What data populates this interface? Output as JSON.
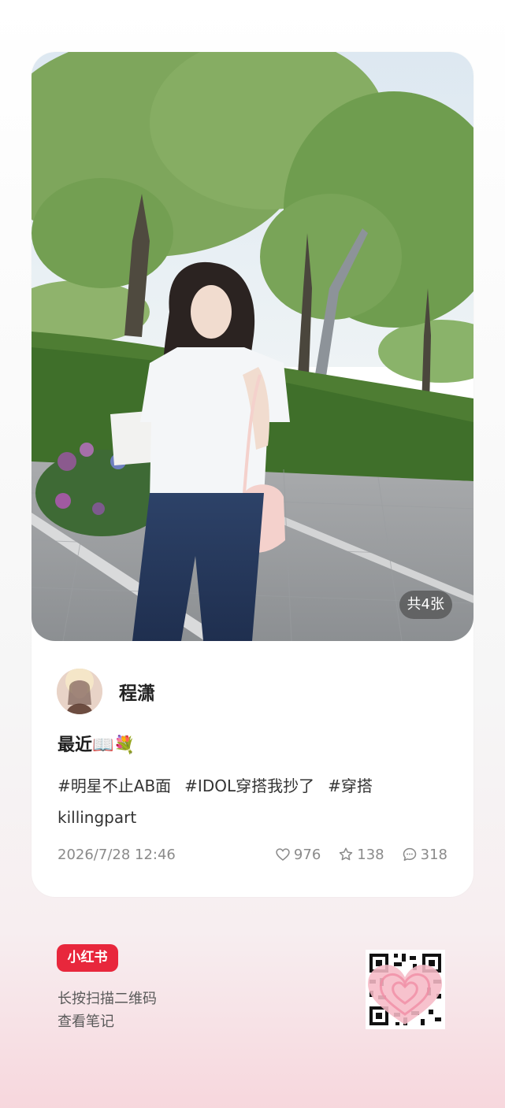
{
  "card": {
    "image_count": "共4张"
  },
  "author": {
    "name": "程潇"
  },
  "note": {
    "title": "最近📖💐",
    "tags": [
      "#明星不止AB面",
      "#IDOL穿搭我抄了",
      "#穿搭"
    ],
    "tags_extra": "killingpart",
    "date": "2026/7/28 12:46",
    "likes": "976",
    "favorites": "138",
    "comments": "318"
  },
  "footer": {
    "brand": "小红书",
    "line1": "长按扫描二维码",
    "line2": "查看笔记"
  },
  "colors": {
    "brand_red": "#e8273c",
    "meta_gray": "#8a8a8a"
  },
  "icons": {
    "like": "heart-icon",
    "favorite": "star-icon",
    "comment": "comment-icon"
  }
}
